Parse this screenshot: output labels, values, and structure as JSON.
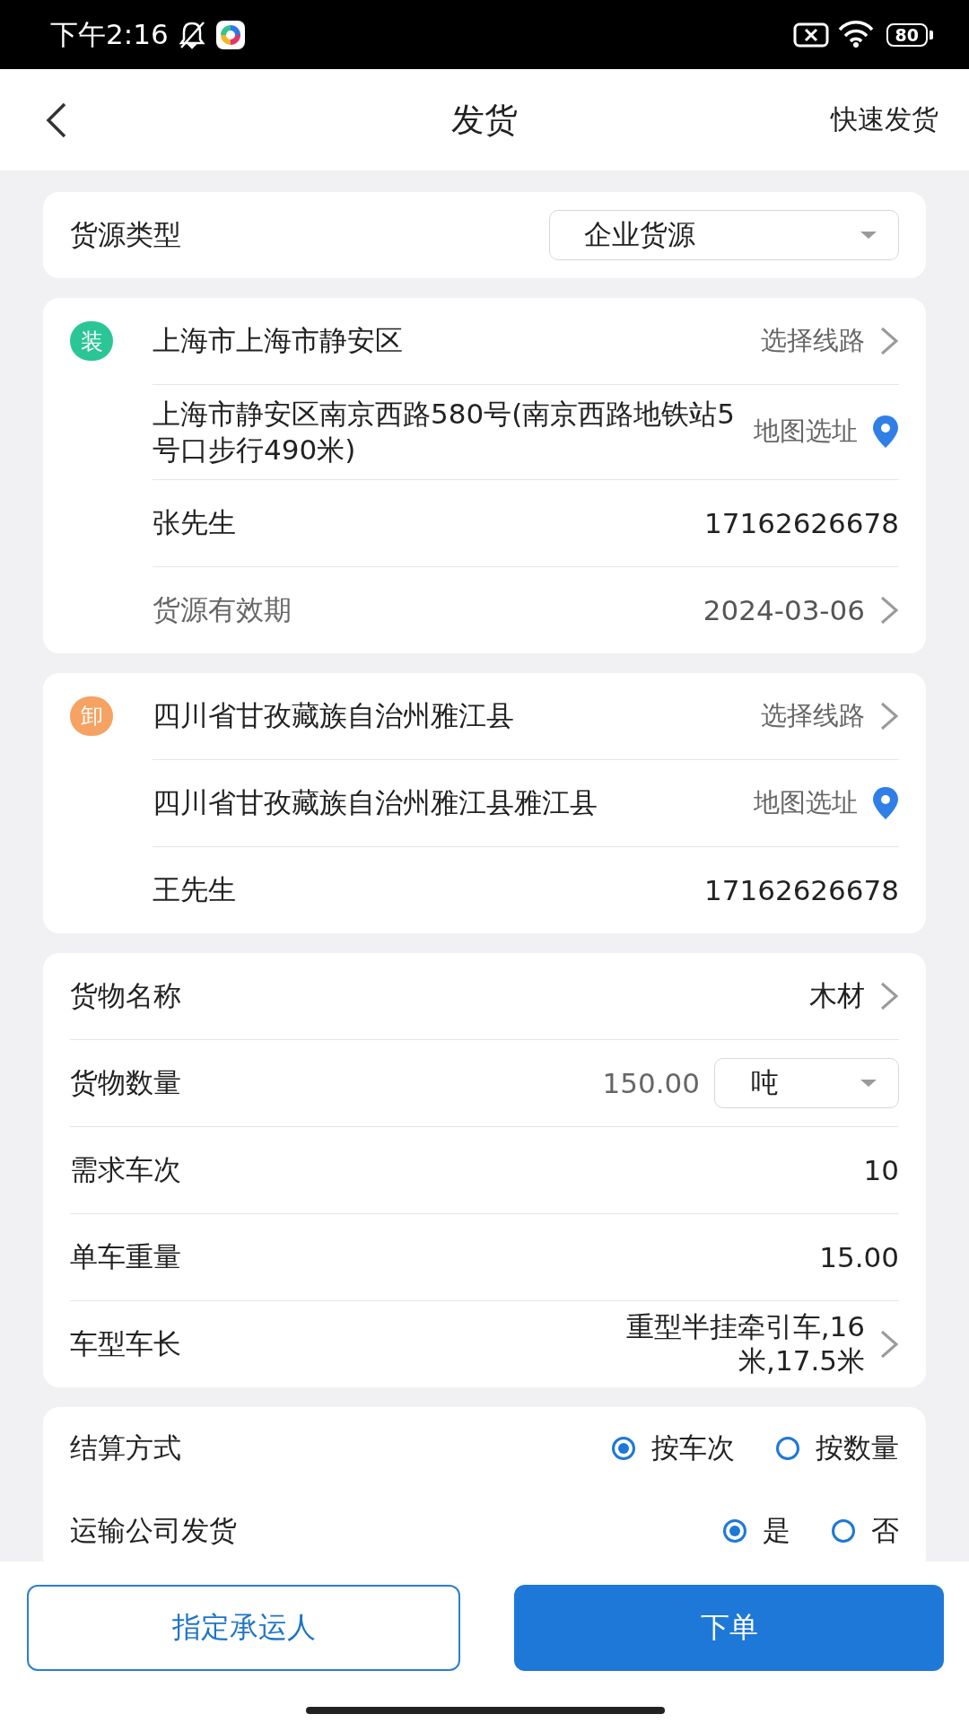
{
  "status_bar": {
    "time": "下午2:16",
    "battery": "80"
  },
  "header": {
    "title": "发货",
    "action": "快速发货"
  },
  "cargo_type": {
    "label": "货源类型",
    "value": "企业货源"
  },
  "stops": [
    {
      "badge": "装",
      "color": "#2bc596",
      "region": "上海市上海市静安区",
      "route_link": "选择线路",
      "address": "上海市静安区南京西路580号(南京西路地铁站5号口步行490米)",
      "map_link": "地图选址",
      "contact": "张先生",
      "phone": "17162626678",
      "validity": {
        "label": "货源有效期",
        "value": "2024-03-06"
      }
    },
    {
      "badge": "卸",
      "color": "#f5a263",
      "region": "四川省甘孜藏族自治州雅江县",
      "route_link": "选择线路",
      "address": "四川省甘孜藏族自治州雅江县雅江县",
      "map_link": "地图选址",
      "contact": "王先生",
      "phone": "17162626678"
    }
  ],
  "goods": [
    {
      "kind": "link",
      "label": "货物名称",
      "value": "木材"
    },
    {
      "kind": "quantity",
      "label": "货物数量",
      "value": "150.00",
      "unit": "吨"
    },
    {
      "kind": "value",
      "label": "需求车次",
      "value": "10"
    },
    {
      "kind": "value",
      "label": "单车重量",
      "value": "15.00"
    },
    {
      "kind": "link",
      "label": "车型车长",
      "value": "重型半挂牵引车,16米,17.5米"
    }
  ],
  "options": [
    {
      "label": "结算方式",
      "choices": [
        {
          "label": "按车次",
          "selected": true
        },
        {
          "label": "按数量",
          "selected": false
        }
      ]
    },
    {
      "label": "运输公司发货",
      "choices": [
        {
          "label": "是",
          "selected": true
        },
        {
          "label": "否",
          "selected": false
        }
      ]
    }
  ],
  "buttons": {
    "secondary": "指定承运人",
    "primary": "下单"
  }
}
